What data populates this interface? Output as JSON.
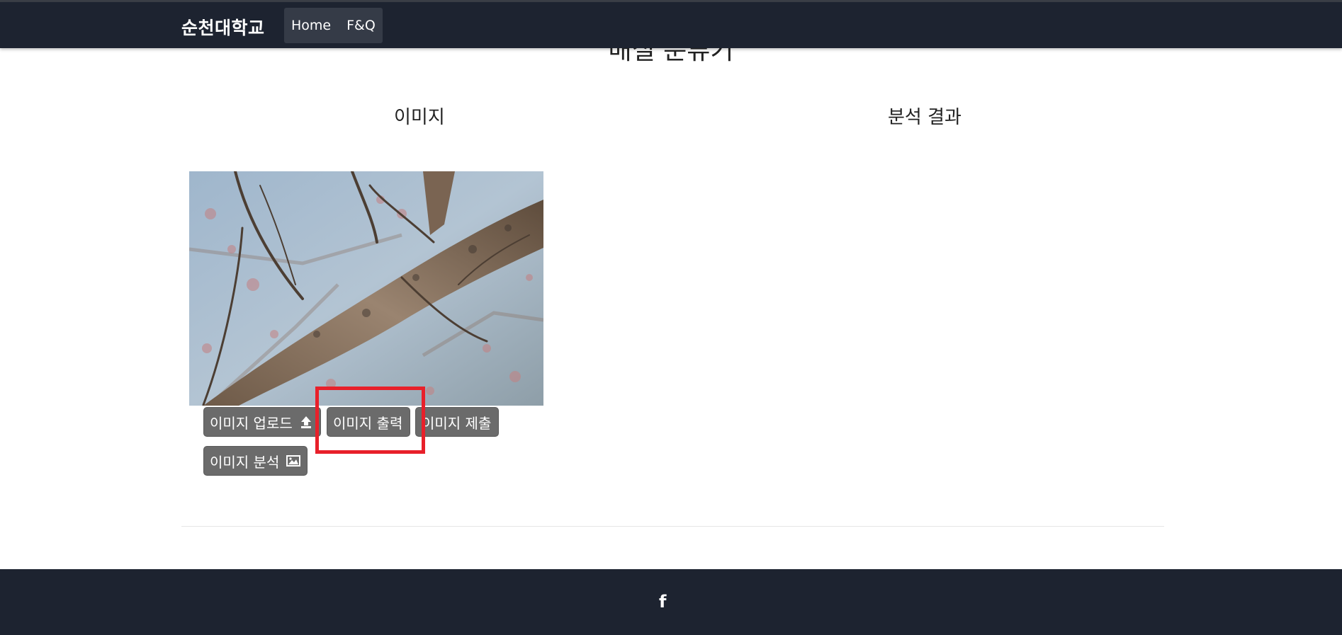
{
  "navbar": {
    "brand": "순천대학교",
    "links": [
      "Home",
      "F&Q"
    ]
  },
  "page": {
    "title": "매실 분류기"
  },
  "columns": {
    "image_title": "이미지",
    "result_title": "분석 결과"
  },
  "buttons": {
    "upload": "이미지 업로드",
    "print": "이미지 출력",
    "submit": "이미지 제출",
    "analyze": "이미지 분석"
  },
  "icons": {
    "upload": "upload-icon",
    "analyze": "image-icon",
    "footer": "facebook-icon"
  },
  "colors": {
    "navbar": "#1d2330",
    "button": "#6b6b6b",
    "highlight": "#e8202a"
  }
}
